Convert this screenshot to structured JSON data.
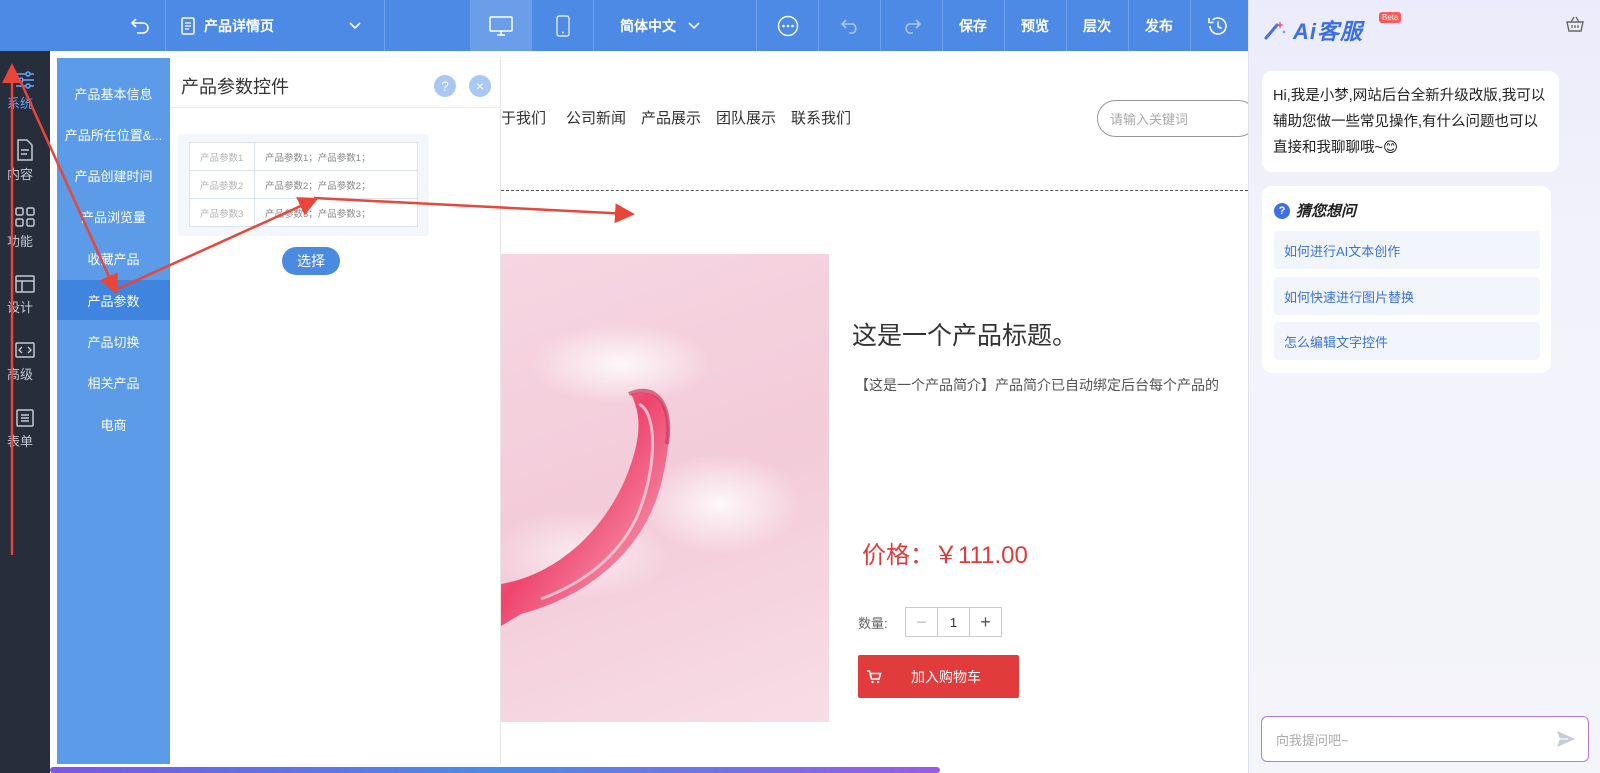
{
  "toolbar": {
    "page_name": "产品详情页",
    "language": "简体中文",
    "save": "保存",
    "preview": "预览",
    "layers": "层次",
    "publish": "发布"
  },
  "rail": {
    "items": [
      {
        "label": "系统"
      },
      {
        "label": "内容"
      },
      {
        "label": "功能"
      },
      {
        "label": "设计"
      },
      {
        "label": "高级"
      },
      {
        "label": "表单"
      }
    ]
  },
  "submenu": {
    "items": [
      {
        "label": "产品基本信息"
      },
      {
        "label": "产品所在位置&..."
      },
      {
        "label": "产品创建时间"
      },
      {
        "label": "产品浏览量"
      },
      {
        "label": "收藏产品"
      },
      {
        "label": "产品参数"
      },
      {
        "label": "产品切换"
      },
      {
        "label": "相关产品"
      },
      {
        "label": "电商"
      }
    ],
    "active_index": 5
  },
  "panel": {
    "title": "产品参数控件",
    "help_symbol": "?",
    "close_symbol": "×",
    "select_label": "选择",
    "preview_rows": [
      {
        "key": "产品参数1",
        "value": "产品参数1；产品参数1；"
      },
      {
        "key": "产品参数2",
        "value": "产品参数2；产品参数2；"
      },
      {
        "key": "产品参数3",
        "value": "产品参数3；产品参数3；"
      }
    ]
  },
  "site": {
    "nav": [
      "于我们",
      "公司新闻",
      "产品展示",
      "团队展示",
      "联系我们"
    ],
    "search_placeholder": "请输入关键词",
    "product_title": "这是一个产品标题。",
    "product_intro": "【这是一个产品简介】产品简介已自动绑定后台每个产品的",
    "price": "价格：￥111.00",
    "qty_label": "数量:",
    "qty_minus": "−",
    "qty_value": "1",
    "qty_plus": "+",
    "add_to_cart": "加入购物车"
  },
  "ai": {
    "title": "Ai客服",
    "beta": "Beta",
    "greeting": "Hi,我是小梦,网站后台全新升级改版,我可以辅助您做一些常见操作,有什么问题也可以直接和我聊聊哦~😊",
    "suggest_title": "猜您想问",
    "suggest_icon": "?",
    "suggestions": [
      "如何进行AI文本创作",
      "如何快速进行图片替换",
      "怎么编辑文字控件"
    ],
    "input_placeholder": "向我提问吧~"
  },
  "colors": {
    "toolbar": "#4d8ae6",
    "rail": "#262d3b",
    "submenu": "#5b9be8",
    "price": "#e03a3a",
    "cart": "#e23b3b",
    "annotation_arrow": "#e8463a"
  }
}
